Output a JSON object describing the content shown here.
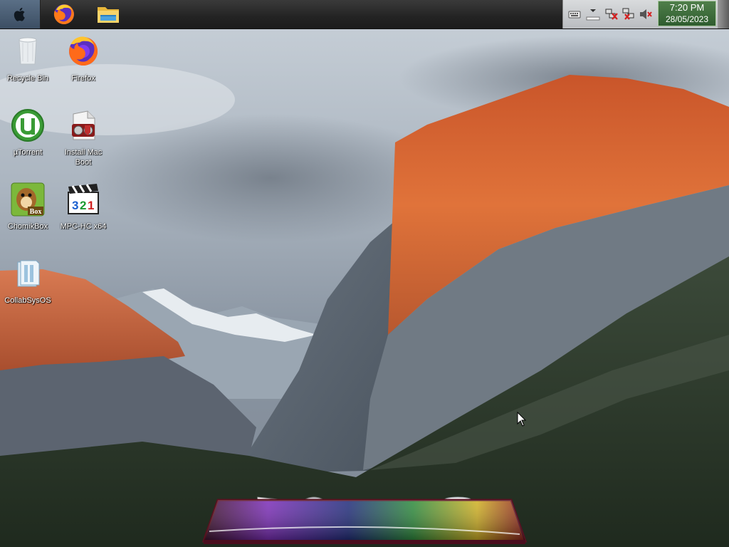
{
  "taskbar": {
    "start_icon": "apple-logo-icon",
    "pinned": [
      {
        "name": "firefox",
        "icon": "firefox-icon"
      },
      {
        "name": "file-explorer",
        "icon": "folder-icon"
      }
    ],
    "tray_icons": [
      "keyboard-icon",
      "volume-slider-icon",
      "network-disconnected-icon",
      "network-error-icon",
      "speaker-muted-icon"
    ],
    "clock": {
      "time": "7:20 PM",
      "date": "28/05/2023"
    }
  },
  "desktop": {
    "icons": [
      {
        "label": "Recycle Bin",
        "icon": "recycle-bin-icon"
      },
      {
        "label": "Firefox",
        "icon": "firefox-icon"
      },
      {
        "label": "µTorrent",
        "icon": "utorrent-icon"
      },
      {
        "label": "Install Mac Boot",
        "icon": "installer-icon"
      },
      {
        "label": "ChomikBox",
        "icon": "chomikbox-icon"
      },
      {
        "label": "MPC-HC x64",
        "icon": "mpc-hc-icon"
      },
      {
        "label": "CollabSysOS",
        "icon": "collabsysos-icon"
      }
    ]
  },
  "dock": {
    "items": [
      "preview-icon",
      "safari-compass-icon",
      "finder-window-icon",
      "brush-tools-icon",
      "trash-icon"
    ]
  },
  "colors": {
    "taskbar": "#232323",
    "tray": "#c9cbce",
    "clock_bg": "#3f6e3c",
    "cliff_glow": "#d9662c"
  }
}
